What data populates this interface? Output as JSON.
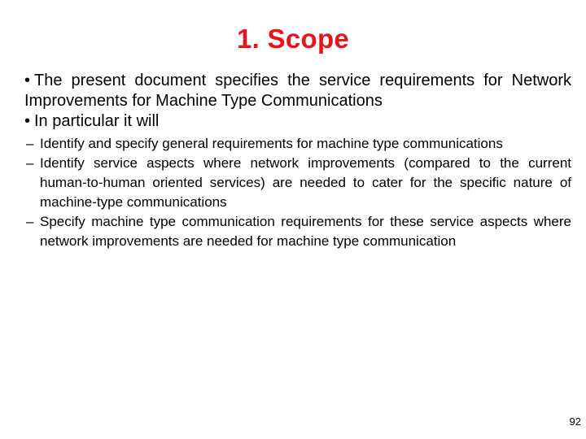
{
  "slide": {
    "title": "1. Scope",
    "title_color": "#e8141b",
    "bullets": [
      {
        "marker": "•",
        "text": "The present document specifies the service requirements for Network Improvements for Machine Type Communications"
      },
      {
        "marker": "•",
        "text": "In particular it will",
        "sub_bullets": [
          {
            "marker": "–",
            "text": "Identify and specify general requirements for machine type communications"
          },
          {
            "marker": "–",
            "text": "Identify service aspects where network improvements (compared to the current human-to-human oriented services) are needed to cater for the specific nature of machine-type communications"
          },
          {
            "marker": "–",
            "text": "Specify machine type communication requirements for these service aspects where network improvements are needed for machine type communication"
          }
        ]
      }
    ],
    "page_number": "92"
  }
}
